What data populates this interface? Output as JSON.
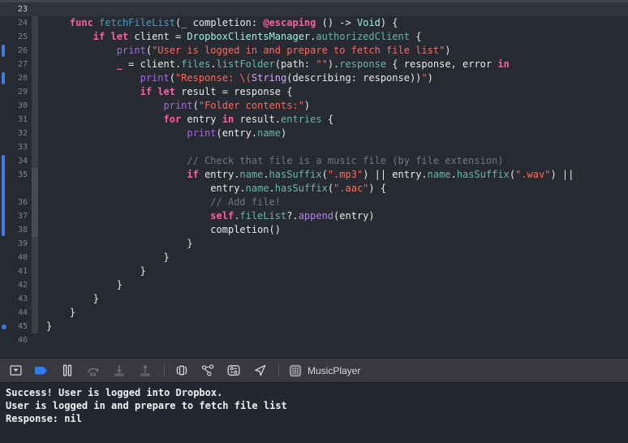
{
  "colors": {
    "change_bar_blue": "#3d7ce0",
    "breakpoint_blue": "#2e7cf5",
    "keyword_pink": "#fc5fa3",
    "string_red": "#fc6a5d",
    "comment_gray": "#6c7986",
    "function_purple": "#a167e6",
    "property_teal": "#67b7a4",
    "type_mint": "#9ef1dd",
    "declaration_cyan": "#41a1c0",
    "system_type_lavender": "#d0a8ff"
  },
  "editor": {
    "lines": [
      {
        "n": "23",
        "hl": true,
        "tokens": []
      },
      {
        "n": "24",
        "f": 1,
        "tokens": [
          [
            "plain",
            "    "
          ],
          [
            "kw",
            "func"
          ],
          [
            "plain",
            " "
          ],
          [
            "decl",
            "fetchFileList"
          ],
          [
            "plain",
            "(_ completion: "
          ],
          [
            "kw",
            "@escaping"
          ],
          [
            "plain",
            " () -> "
          ],
          [
            "type",
            "Void"
          ],
          [
            "plain",
            ") {"
          ]
        ]
      },
      {
        "n": "25",
        "f": 1,
        "tokens": [
          [
            "plain",
            "        "
          ],
          [
            "kw",
            "if"
          ],
          [
            "plain",
            " "
          ],
          [
            "kw",
            "let"
          ],
          [
            "plain",
            " client = "
          ],
          [
            "type",
            "DropboxClientsManager"
          ],
          [
            "plain",
            "."
          ],
          [
            "prop",
            "authorizedClient"
          ],
          [
            "plain",
            " {"
          ]
        ]
      },
      {
        "n": "26",
        "f": 1,
        "mark": "bar",
        "tokens": [
          [
            "plain",
            "            "
          ],
          [
            "fn",
            "print"
          ],
          [
            "plain",
            "("
          ],
          [
            "str",
            "\"User is logged in and prepare to fetch file list\""
          ],
          [
            "plain",
            ")"
          ]
        ]
      },
      {
        "n": "27",
        "f": 1,
        "tokens": [
          [
            "plain",
            "            "
          ],
          [
            "kw",
            "_"
          ],
          [
            "plain",
            " = client."
          ],
          [
            "prop",
            "files"
          ],
          [
            "plain",
            "."
          ],
          [
            "prop",
            "listFolder"
          ],
          [
            "plain",
            "(path: "
          ],
          [
            "str",
            "\"\""
          ],
          [
            "plain",
            ")."
          ],
          [
            "prop",
            "response"
          ],
          [
            "plain",
            " { response, error "
          ],
          [
            "kw",
            "in"
          ]
        ]
      },
      {
        "n": "28",
        "f": 1,
        "mark": "bar",
        "tokens": [
          [
            "plain",
            "                "
          ],
          [
            "fn",
            "print"
          ],
          [
            "plain",
            "("
          ],
          [
            "str",
            "\"Response: \\("
          ],
          [
            "sys",
            "String"
          ],
          [
            "plain",
            "(describing: response))"
          ],
          [
            "str",
            "\""
          ],
          [
            "plain",
            ")"
          ]
        ]
      },
      {
        "n": "29",
        "f": 1,
        "tokens": [
          [
            "plain",
            "                "
          ],
          [
            "kw",
            "if"
          ],
          [
            "plain",
            " "
          ],
          [
            "kw",
            "let"
          ],
          [
            "plain",
            " result = response {"
          ]
        ]
      },
      {
        "n": "30",
        "f": 1,
        "tokens": [
          [
            "plain",
            "                    "
          ],
          [
            "fn",
            "print"
          ],
          [
            "plain",
            "("
          ],
          [
            "str",
            "\"Folder contents:\""
          ],
          [
            "plain",
            ")"
          ]
        ]
      },
      {
        "n": "31",
        "f": 1,
        "tokens": [
          [
            "plain",
            "                    "
          ],
          [
            "kw",
            "for"
          ],
          [
            "plain",
            " entry "
          ],
          [
            "kw",
            "in"
          ],
          [
            "plain",
            " result."
          ],
          [
            "prop",
            "entries"
          ],
          [
            "plain",
            " {"
          ]
        ]
      },
      {
        "n": "32",
        "f": 1,
        "tokens": [
          [
            "plain",
            "                        "
          ],
          [
            "fn",
            "print"
          ],
          [
            "plain",
            "(entry."
          ],
          [
            "prop",
            "name"
          ],
          [
            "plain",
            ")"
          ]
        ]
      },
      {
        "n": "33",
        "f": 1,
        "tokens": []
      },
      {
        "n": "34",
        "f": 1,
        "mark": "barTop",
        "tokens": [
          [
            "plain",
            "                        "
          ],
          [
            "cmt",
            "// Check that file is a music file (by file extension)"
          ]
        ]
      },
      {
        "n": "35",
        "f": 2,
        "mark": "barMid",
        "tokens": [
          [
            "plain",
            "                        "
          ],
          [
            "kw",
            "if"
          ],
          [
            "plain",
            " entry."
          ],
          [
            "prop",
            "name"
          ],
          [
            "plain",
            "."
          ],
          [
            "prop",
            "hasSuffix"
          ],
          [
            "plain",
            "("
          ],
          [
            "str",
            "\".mp3\""
          ],
          [
            "plain",
            ") || entry."
          ],
          [
            "prop",
            "name"
          ],
          [
            "plain",
            "."
          ],
          [
            "prop",
            "hasSuffix"
          ],
          [
            "plain",
            "("
          ],
          [
            "str",
            "\".wav\""
          ],
          [
            "plain",
            ") ||"
          ]
        ]
      },
      {
        "n": "",
        "f": 2,
        "mark": "barMid",
        "tokens": [
          [
            "plain",
            "                            entry."
          ],
          [
            "prop",
            "name"
          ],
          [
            "plain",
            "."
          ],
          [
            "prop",
            "hasSuffix"
          ],
          [
            "plain",
            "("
          ],
          [
            "str",
            "\".aac\""
          ],
          [
            "plain",
            ") {"
          ]
        ]
      },
      {
        "n": "36",
        "f": 2,
        "mark": "barMid",
        "tokens": [
          [
            "plain",
            "                            "
          ],
          [
            "cmt",
            "// Add file!"
          ]
        ]
      },
      {
        "n": "37",
        "f": 2,
        "mark": "barMid",
        "tokens": [
          [
            "plain",
            "                            "
          ],
          [
            "kw",
            "self"
          ],
          [
            "plain",
            "."
          ],
          [
            "prop",
            "fileList"
          ],
          [
            "plain",
            "?."
          ],
          [
            "fn2",
            "append"
          ],
          [
            "plain",
            "(entry)"
          ]
        ]
      },
      {
        "n": "38",
        "f": 2,
        "mark": "barBot",
        "tokens": [
          [
            "plain",
            "                            completion()"
          ]
        ]
      },
      {
        "n": "39",
        "f": 1,
        "tokens": [
          [
            "plain",
            "                        }"
          ]
        ]
      },
      {
        "n": "40",
        "f": 1,
        "tokens": [
          [
            "plain",
            "                    }"
          ]
        ]
      },
      {
        "n": "41",
        "f": 1,
        "tokens": [
          [
            "plain",
            "                }"
          ]
        ]
      },
      {
        "n": "42",
        "f": 1,
        "tokens": [
          [
            "plain",
            "            }"
          ]
        ]
      },
      {
        "n": "43",
        "f": 1,
        "tokens": [
          [
            "plain",
            "        }"
          ]
        ]
      },
      {
        "n": "44",
        "f": 1,
        "tokens": [
          [
            "plain",
            "    }"
          ]
        ]
      },
      {
        "n": "45",
        "f": 1,
        "mark": "dot",
        "tokens": [
          [
            "plain",
            "}"
          ]
        ]
      },
      {
        "n": "46",
        "tokens": []
      }
    ]
  },
  "debug_bar": {
    "buttons": [
      {
        "name": "hide-debug-area-button",
        "icon": "chevron-down-square-icon",
        "enabled": true
      },
      {
        "name": "breakpoints-toggle-button",
        "icon": "breakpoint-arrow-icon",
        "enabled": true,
        "accent": true
      },
      {
        "name": "pause-button",
        "icon": "pause-icon",
        "enabled": true
      },
      {
        "name": "step-over-button",
        "icon": "step-over-icon",
        "enabled": false
      },
      {
        "name": "step-into-button",
        "icon": "step-into-icon",
        "enabled": false
      },
      {
        "name": "step-out-button",
        "icon": "step-out-icon",
        "enabled": false
      },
      {
        "sep": true
      },
      {
        "name": "view-hierarchy-button",
        "icon": "view-hierarchy-icon",
        "enabled": true
      },
      {
        "name": "memory-graph-button",
        "icon": "memory-graph-icon",
        "enabled": true
      },
      {
        "name": "environment-overrides-button",
        "icon": "environment-overrides-icon",
        "enabled": true
      },
      {
        "name": "simulate-location-button",
        "icon": "location-arrow-icon",
        "enabled": true
      },
      {
        "sep": true
      }
    ],
    "process_name": "MusicPlayer"
  },
  "console": {
    "lines": [
      "Success! User is logged into Dropbox.",
      "User is logged in and prepare to fetch file list",
      "Response: nil"
    ]
  }
}
